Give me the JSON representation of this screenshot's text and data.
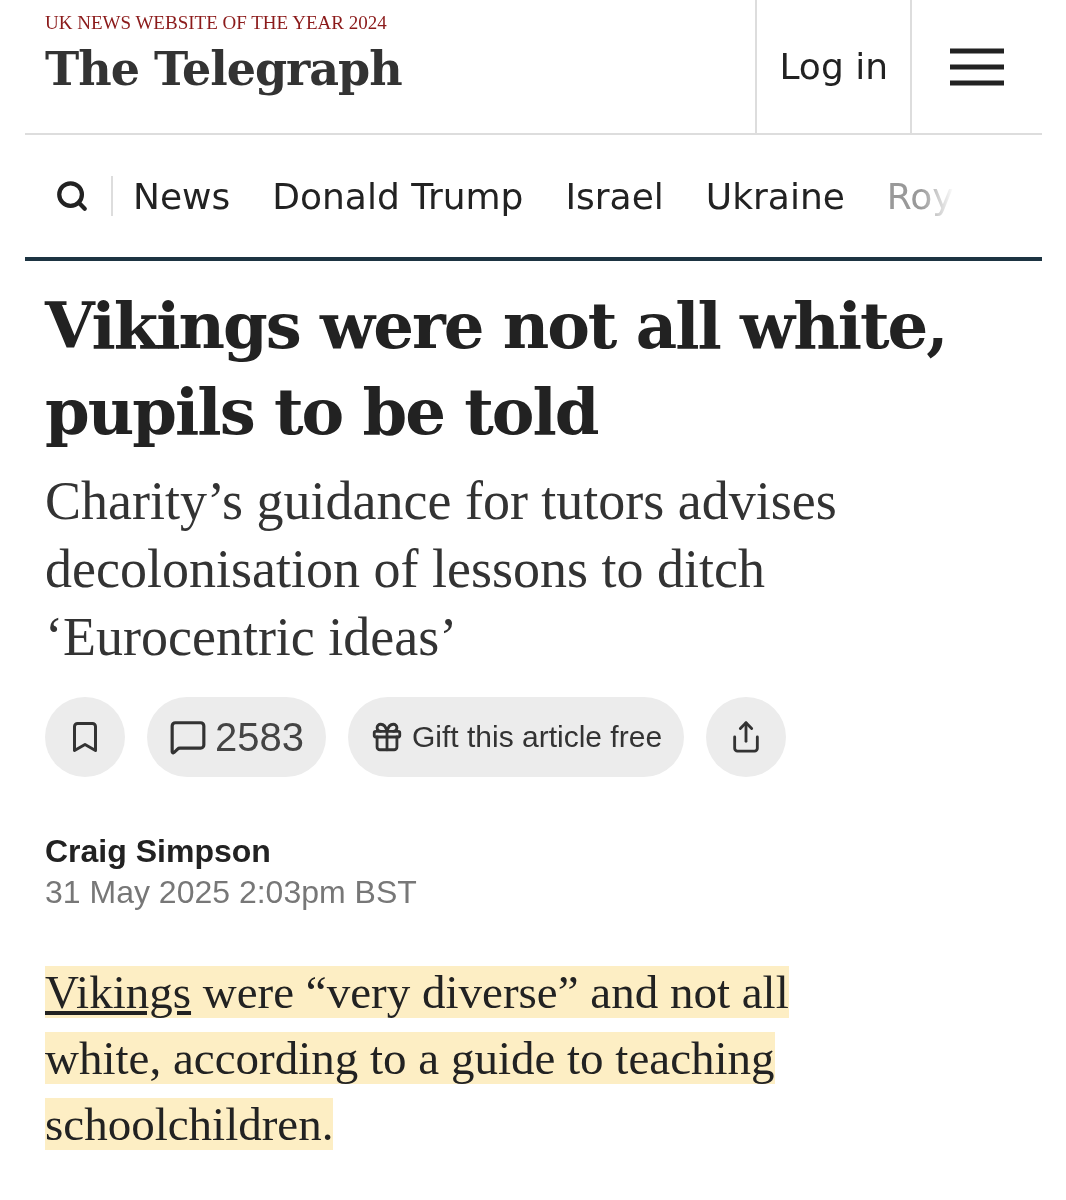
{
  "header": {
    "award": "UK NEWS WEBSITE OF THE YEAR 2024",
    "logo": "The Telegraph",
    "login": "Log in"
  },
  "nav": {
    "items": [
      {
        "label": "News",
        "cut_off": false
      },
      {
        "label": "Donald Trump",
        "cut_off": false
      },
      {
        "label": "Israel",
        "cut_off": false
      },
      {
        "label": "Ukraine",
        "cut_off": false
      },
      {
        "label": "Roy",
        "cut_off": true
      }
    ]
  },
  "article": {
    "headline": "Vikings were not all white, pupils to be told",
    "standfirst": "Charity’s guidance for tutors advises decolonisation of lessons to ditch ‘Eurocentric ideas’",
    "actions": {
      "comments": "2583",
      "gift": "Gift this article free"
    },
    "author": "Craig Simpson",
    "date": "31 May 2025 2:03pm BST",
    "lead": {
      "link": "Vikings",
      "text": " were “very diverse” and not all white, according to a guide to teaching schoolchildren.",
      "highlighted": true
    }
  }
}
